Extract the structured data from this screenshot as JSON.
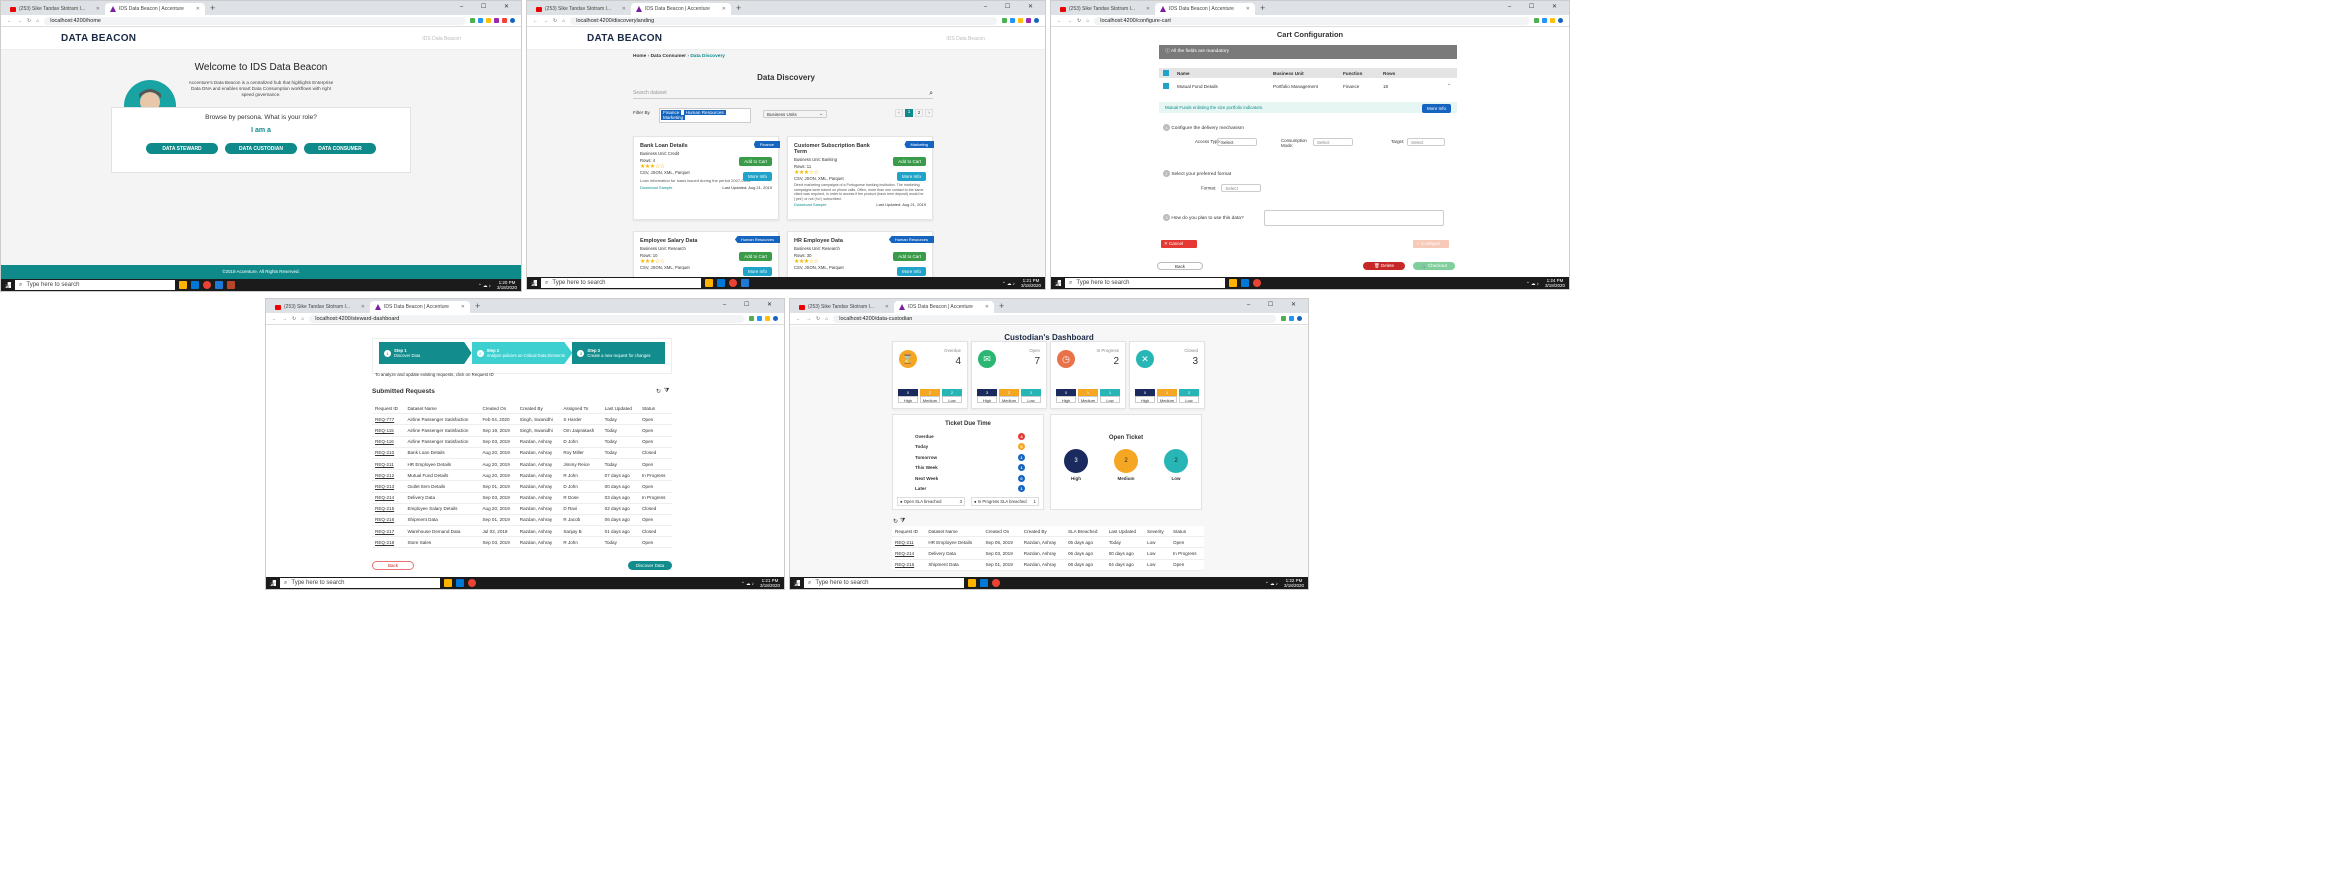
{
  "browser": {
    "tab_youtube": "(253) Sike Tandav Stotram I...",
    "tab_ids": "IDS Data Beacon | Accenture",
    "search_placeholder": "Type here to search",
    "date": "3/18/2020"
  },
  "s1": {
    "url": "localhost:4200/home",
    "time": "1:20 PM",
    "logo": "DATA BEACON",
    "welcome_user": "Welcome Banner",
    "title": "Welcome to IDS Data Beacon",
    "desc": "Accenture's Data Beacon is a centralized hub that highlights Enterprise Data DNA and enables smart Data Consumption workflows with right speed governance.",
    "browse": "Browse by persona. What is your role?",
    "iam": "I am a",
    "btn1": "DATA STEWARD",
    "btn2": "DATA CUSTODIAN",
    "btn3": "DATA CONSUMER",
    "footer": "©2019 Accenture. All Rights Reserved."
  },
  "s2": {
    "url": "localhost:4200/discoverylanding",
    "time": "1:21 PM",
    "logo": "DATA BEACON",
    "bc1": "Home",
    "bc2": "Data Consumer",
    "bc3": "Data Discovery",
    "title": "Data Discovery",
    "search_placeholder": "Search dataset",
    "filter_by": "Filter By",
    "chip1": "Finance",
    "chip2": "Human Resources",
    "chip3": "Marketing",
    "bu": "Business Units",
    "page1": "1",
    "page2": "2",
    "cards": [
      {
        "title": "Bank Loan Details",
        "unit": "Business Unit: Credit",
        "rows": "Rows: 4",
        "formats": "CSV, JSON, XML, Parquet",
        "desc": "Loan information for loans issued during the period 2007-2015.",
        "sample": "Download Sample",
        "updated": "Last Updated: Aug 21, 2019",
        "tag": "Finance"
      },
      {
        "title": "Customer Subscription Bank Term",
        "unit": "Business Unit: Banking",
        "rows": "Rows: 11",
        "formats": "CSV, JSON, XML, Parquet",
        "desc": "Direct marketing campaigns of a Portuguese banking institution. The marketing campaigns were based on phone calls. Often, more than one contact to the same client was required, in order to access if the product (bank term deposit) would be ('yes') or not ('no') subscribed.",
        "sample": "Download Sample",
        "updated": "Last Updated: Aug 21, 2019",
        "tag": "Marketing"
      },
      {
        "title": "Employee Salary Data",
        "unit": "Business Unit: Research",
        "rows": "Rows: 10",
        "formats": "CSV, JSON, XML, Parquet",
        "tag": "Human Resources"
      },
      {
        "title": "HR Employee Data",
        "unit": "Business Unit: Research",
        "rows": "Rows: 30",
        "formats": "CSV, JSON, XML, Parquet",
        "tag": "Human Resources"
      }
    ],
    "add_cart": "Add to Cart",
    "more_info": "More Info"
  },
  "s3": {
    "url": "localhost:4200/configure-cart",
    "time": "1:24 PM",
    "title": "Cart Configuration",
    "mandatory": "All the fields are mandatory",
    "h_name": "Name",
    "h_bu": "Business Unit",
    "h_fn": "Function",
    "h_rows": "Rows",
    "r_name": "Mutual Fund Details",
    "r_bu": "Portfolio Management",
    "r_fn": "Finance",
    "r_rows": "18",
    "info": "Mutual Funds enlisting the size portfolio indicators.",
    "more_info": "More Info",
    "step1": "Configure the delivery mechanism",
    "access": "Access Type:",
    "consumption": "Consumption Mode:",
    "target": "Target:",
    "select": "Select",
    "step2": "Select your preferred format",
    "format": "Format:",
    "step3": "How do you plan to use this data?",
    "cancel": "Cancel",
    "configure": "Configure",
    "back": "Back",
    "delete": "Delete",
    "checkout": "Checkout"
  },
  "s4": {
    "url": "localhost:4200/steward-dashboard",
    "time": "1:21 PM",
    "steps": [
      {
        "n": "1",
        "title": "Step 1",
        "sub": "Discover Data"
      },
      {
        "n": "2",
        "title": "Step 2",
        "sub": "Analyze policies on Critical Data Elements"
      },
      {
        "n": "3",
        "title": "Step 3",
        "sub": "Create a new request for changes"
      }
    ],
    "hint": "To analyze and update existing requests, click on Request ID",
    "title": "Submitted Requests",
    "headers": [
      "Request ID",
      "Dataset Name",
      "Created On",
      "Created By",
      "Assigned To",
      "Last Updated",
      "Status"
    ],
    "rows": [
      [
        "REQ-777",
        "Airline Passenger Satisfaction",
        "Feb 04, 2020",
        "Singh, Swanidhi",
        "S Harder",
        "Today",
        "Open"
      ],
      [
        "REQ-115",
        "Airline Passenger Satisfaction",
        "Sep 19, 2019",
        "Singh, Swanidhi",
        "Om Jaiprakash",
        "Today",
        "Open"
      ],
      [
        "REQ-116",
        "Airline Passenger Satisfaction",
        "Sep 03, 2019",
        "Razdan, Ashray",
        "D John",
        "Today",
        "Open"
      ],
      [
        "REQ-210",
        "Bank Loan Details",
        "Aug 20, 2019",
        "Razdan, Ashray",
        "Roy Miller",
        "Today",
        "Closed"
      ],
      [
        "REQ-211",
        "HR Employee Details",
        "Aug 20, 2019",
        "Razdan, Ashray",
        "Jimmy Reice",
        "Today",
        "Open"
      ],
      [
        "REQ-212",
        "Mutual Fund Details",
        "Aug 20, 2019",
        "Razdan, Ashray",
        "R John",
        "07 days ago",
        "In Progress"
      ],
      [
        "REQ-213",
        "Outlet Item Details",
        "Sep 01, 2019",
        "Razdan, Ashray",
        "D John",
        "00 days ago",
        "Open"
      ],
      [
        "REQ-214",
        "Delivery Data",
        "Sep 03, 2019",
        "Razdan, Ashray",
        "R Dose",
        "03 days ago",
        "In Progress"
      ],
      [
        "REQ-215",
        "Employee Salary Details",
        "Aug 20, 2019",
        "Razdan, Ashray",
        "D Ravi",
        "02 days ago",
        "Closed"
      ],
      [
        "REQ-216",
        "Shipment Data",
        "Sep 01, 2019",
        "Razdan, Ashray",
        "R Jacob",
        "06 days ago",
        "Open"
      ],
      [
        "REQ-217",
        "Warehouse Demand Data",
        "Jul 03, 2019",
        "Razdan, Ashray",
        "Sanjay B",
        "01 days ago",
        "Closed"
      ],
      [
        "REQ-218",
        "Store Sales",
        "Sep 03, 2019",
        "Razdan, Ashray",
        "R John",
        "Today",
        "Open"
      ]
    ],
    "back": "Back",
    "discover": "Discover Data"
  },
  "s5": {
    "url": "localhost:4200/data-custodian",
    "time": "1:22 PM",
    "title": "Custodian's Dashboard",
    "kpis": [
      {
        "label": "Overdue",
        "value": "4",
        "color": "#f5a623",
        "h": "0",
        "m": "2",
        "l": "2"
      },
      {
        "label": "Open",
        "value": "7",
        "color": "#2bb673",
        "h": "3",
        "m": "2",
        "l": "2"
      },
      {
        "label": "In Progress",
        "value": "2",
        "color": "#e8734a",
        "h": "0",
        "m": "1",
        "l": "1"
      },
      {
        "label": "Closed",
        "value": "3",
        "color": "#27b5b5",
        "h": "0",
        "m": "1",
        "l": "2"
      }
    ],
    "high": "High",
    "medium": "Medium",
    "low": "Low",
    "due_title": "Ticket Due Time",
    "due": [
      {
        "label": "Overdue",
        "value": "4",
        "color": "#e53935"
      },
      {
        "label": "Today",
        "value": "0",
        "color": "#f5a623"
      },
      {
        "label": "Tomorrow",
        "value": "1",
        "color": "#1565c0"
      },
      {
        "label": "This Week",
        "value": "1",
        "color": "#1565c0"
      },
      {
        "label": "Next Week",
        "value": "0",
        "color": "#1565c0"
      },
      {
        "label": "Later",
        "value": "1",
        "color": "#1565c0"
      }
    ],
    "open_sla": "Open SLA breached",
    "open_sla_v": "3",
    "prog_sla": "In Progress SLA breached",
    "prog_sla_v": "1",
    "open_title": "Open Ticket",
    "open_high": "3",
    "open_med": "2",
    "open_low": "2",
    "headers": [
      "Request ID",
      "Dataset Name",
      "Created On",
      "Created By",
      "SLA Breached",
      "Last Updated",
      "Severity",
      "Status"
    ],
    "rows": [
      [
        "REQ-211",
        "HR Employee Details",
        "Sep 05, 2019",
        "Razdan, Ashray",
        "05 days ago",
        "Today",
        "Low",
        "Open"
      ],
      [
        "REQ-214",
        "Delivery Data",
        "Sep 03, 2019",
        "Razdan, Ashray",
        "06 days ago",
        "00 days ago",
        "Low",
        "In Progress"
      ],
      [
        "REQ-216",
        "Shipment Data",
        "Sep 01, 2019",
        "Razdan, Ashray",
        "06 days ago",
        "04 days ago",
        "Low",
        "Open"
      ]
    ]
  }
}
